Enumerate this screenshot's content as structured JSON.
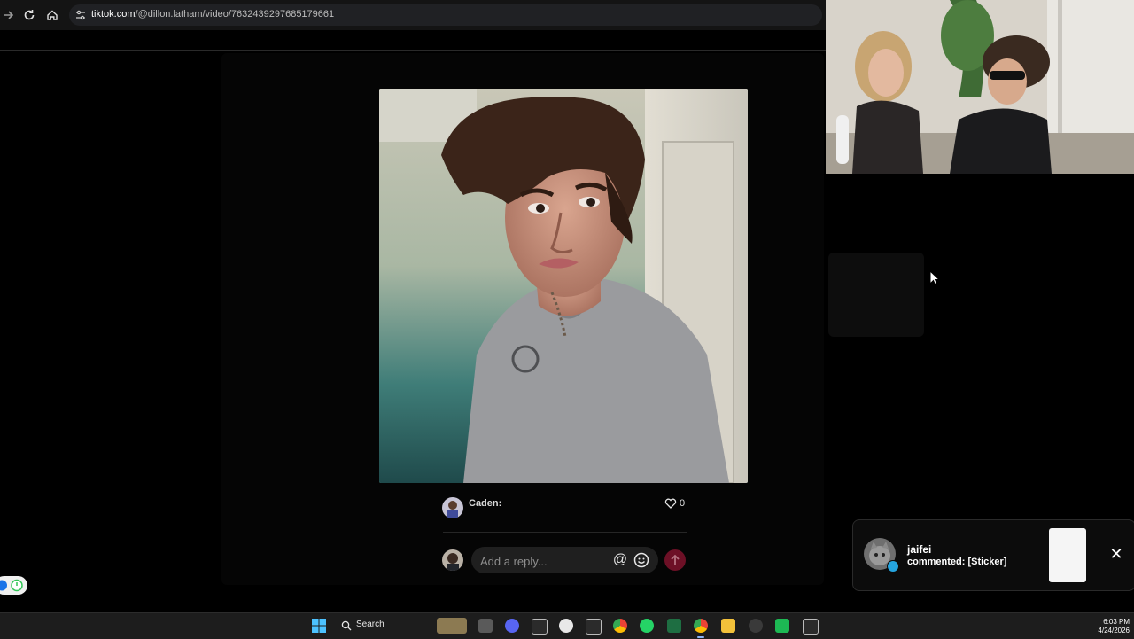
{
  "browser": {
    "url_host": "tiktok.com",
    "url_path": "/@dillon.latham/video/7632439297685179661"
  },
  "comment": {
    "author": "Caden:",
    "likes": "0"
  },
  "reply": {
    "placeholder": "Add a reply...",
    "mention_symbol": "@"
  },
  "notification": {
    "user": "jaifei",
    "message": "commented: [Sticker]",
    "close_symbol": "✕"
  },
  "taskbar": {
    "search_label": "Search",
    "time": "6:03 PM",
    "date": "4/24/2026"
  },
  "colors": {
    "send_button": "#6d1026",
    "verified_badge": "#25a5e0",
    "background": "#000000"
  }
}
